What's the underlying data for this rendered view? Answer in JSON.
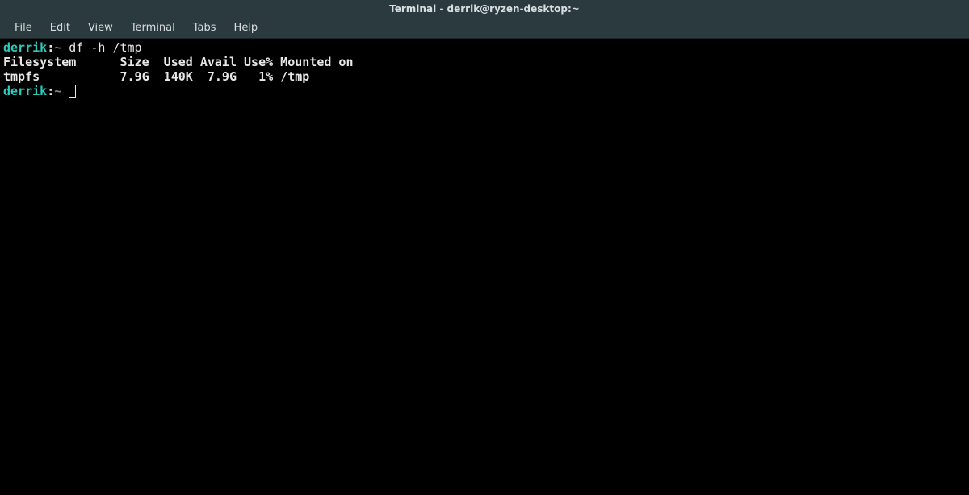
{
  "window": {
    "title": "Terminal - derrik@ryzen-desktop:~"
  },
  "menu": {
    "file": "File",
    "edit": "Edit",
    "view": "View",
    "terminal": "Terminal",
    "tabs": "Tabs",
    "help": "Help"
  },
  "prompt": {
    "user": "derrik",
    "sep": ":",
    "path": "~",
    "command": "df -h /tmp"
  },
  "output": {
    "header": "Filesystem      Size  Used Avail Use% Mounted on",
    "row": "tmpfs           7.9G  140K  7.9G   1% /tmp"
  },
  "prompt2": {
    "user": "derrik",
    "sep": ":",
    "path": "~"
  }
}
